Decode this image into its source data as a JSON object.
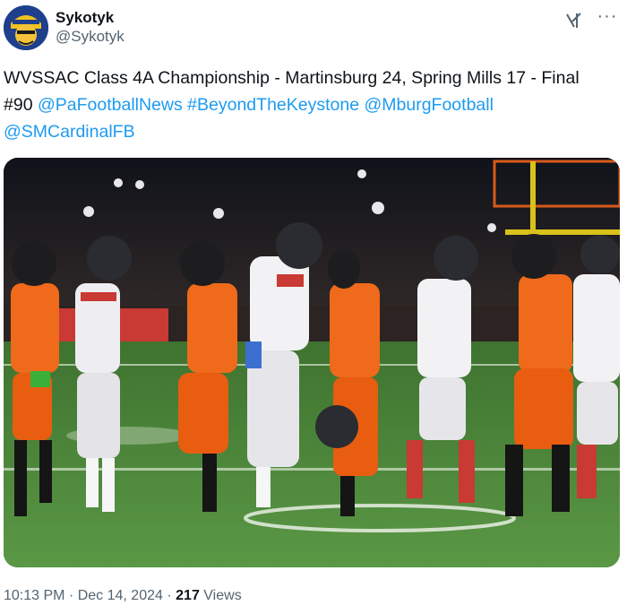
{
  "author": {
    "display_name": "Sykotyk",
    "handle": "@Sykotyk",
    "avatar_icon": "avatar-yellow-helmet-face"
  },
  "header_icons": [
    "grok-icon",
    "more-icon"
  ],
  "tweet": {
    "text_plain": "WVSSAC Class 4A Championship - Martinsburg 24, Spring Mills 17 - Final #90",
    "links": [
      "@PaFootballNews",
      "#BeyondTheKeystone",
      "@MburgFootball",
      "@SMCardinalFB"
    ]
  },
  "meta": {
    "time": "10:13 PM",
    "date": "Dec 14, 2024",
    "views_count": "217",
    "views_label": "Views"
  },
  "colors": {
    "link": "#1d9bf0",
    "secondary_text": "#536471",
    "orange_jersey": "#ef6a1a",
    "white_jersey": "#f2f2f4",
    "field": "#4f8a3c"
  }
}
